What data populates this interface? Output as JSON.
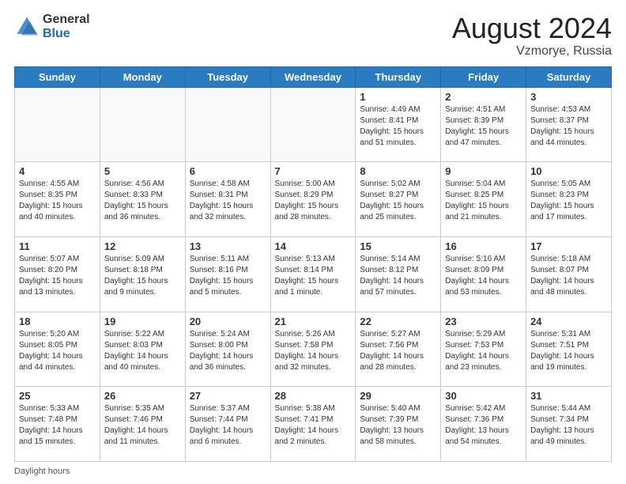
{
  "logo": {
    "general": "General",
    "blue": "Blue"
  },
  "title": {
    "month_year": "August 2024",
    "location": "Vzmorye, Russia"
  },
  "days_of_week": [
    "Sunday",
    "Monday",
    "Tuesday",
    "Wednesday",
    "Thursday",
    "Friday",
    "Saturday"
  ],
  "weeks": [
    [
      {
        "day": "",
        "info": ""
      },
      {
        "day": "",
        "info": ""
      },
      {
        "day": "",
        "info": ""
      },
      {
        "day": "",
        "info": ""
      },
      {
        "day": "1",
        "info": "Sunrise: 4:49 AM\nSunset: 8:41 PM\nDaylight: 15 hours\nand 51 minutes."
      },
      {
        "day": "2",
        "info": "Sunrise: 4:51 AM\nSunset: 8:39 PM\nDaylight: 15 hours\nand 47 minutes."
      },
      {
        "day": "3",
        "info": "Sunrise: 4:53 AM\nSunset: 8:37 PM\nDaylight: 15 hours\nand 44 minutes."
      }
    ],
    [
      {
        "day": "4",
        "info": "Sunrise: 4:55 AM\nSunset: 8:35 PM\nDaylight: 15 hours\nand 40 minutes."
      },
      {
        "day": "5",
        "info": "Sunrise: 4:56 AM\nSunset: 8:33 PM\nDaylight: 15 hours\nand 36 minutes."
      },
      {
        "day": "6",
        "info": "Sunrise: 4:58 AM\nSunset: 8:31 PM\nDaylight: 15 hours\nand 32 minutes."
      },
      {
        "day": "7",
        "info": "Sunrise: 5:00 AM\nSunset: 8:29 PM\nDaylight: 15 hours\nand 28 minutes."
      },
      {
        "day": "8",
        "info": "Sunrise: 5:02 AM\nSunset: 8:27 PM\nDaylight: 15 hours\nand 25 minutes."
      },
      {
        "day": "9",
        "info": "Sunrise: 5:04 AM\nSunset: 8:25 PM\nDaylight: 15 hours\nand 21 minutes."
      },
      {
        "day": "10",
        "info": "Sunrise: 5:05 AM\nSunset: 8:23 PM\nDaylight: 15 hours\nand 17 minutes."
      }
    ],
    [
      {
        "day": "11",
        "info": "Sunrise: 5:07 AM\nSunset: 8:20 PM\nDaylight: 15 hours\nand 13 minutes."
      },
      {
        "day": "12",
        "info": "Sunrise: 5:09 AM\nSunset: 8:18 PM\nDaylight: 15 hours\nand 9 minutes."
      },
      {
        "day": "13",
        "info": "Sunrise: 5:11 AM\nSunset: 8:16 PM\nDaylight: 15 hours\nand 5 minutes."
      },
      {
        "day": "14",
        "info": "Sunrise: 5:13 AM\nSunset: 8:14 PM\nDaylight: 15 hours\nand 1 minute."
      },
      {
        "day": "15",
        "info": "Sunrise: 5:14 AM\nSunset: 8:12 PM\nDaylight: 14 hours\nand 57 minutes."
      },
      {
        "day": "16",
        "info": "Sunrise: 5:16 AM\nSunset: 8:09 PM\nDaylight: 14 hours\nand 53 minutes."
      },
      {
        "day": "17",
        "info": "Sunrise: 5:18 AM\nSunset: 8:07 PM\nDaylight: 14 hours\nand 48 minutes."
      }
    ],
    [
      {
        "day": "18",
        "info": "Sunrise: 5:20 AM\nSunset: 8:05 PM\nDaylight: 14 hours\nand 44 minutes."
      },
      {
        "day": "19",
        "info": "Sunrise: 5:22 AM\nSunset: 8:03 PM\nDaylight: 14 hours\nand 40 minutes."
      },
      {
        "day": "20",
        "info": "Sunrise: 5:24 AM\nSunset: 8:00 PM\nDaylight: 14 hours\nand 36 minutes."
      },
      {
        "day": "21",
        "info": "Sunrise: 5:26 AM\nSunset: 7:58 PM\nDaylight: 14 hours\nand 32 minutes."
      },
      {
        "day": "22",
        "info": "Sunrise: 5:27 AM\nSunset: 7:56 PM\nDaylight: 14 hours\nand 28 minutes."
      },
      {
        "day": "23",
        "info": "Sunrise: 5:29 AM\nSunset: 7:53 PM\nDaylight: 14 hours\nand 23 minutes."
      },
      {
        "day": "24",
        "info": "Sunrise: 5:31 AM\nSunset: 7:51 PM\nDaylight: 14 hours\nand 19 minutes."
      }
    ],
    [
      {
        "day": "25",
        "info": "Sunrise: 5:33 AM\nSunset: 7:48 PM\nDaylight: 14 hours\nand 15 minutes."
      },
      {
        "day": "26",
        "info": "Sunrise: 5:35 AM\nSunset: 7:46 PM\nDaylight: 14 hours\nand 11 minutes."
      },
      {
        "day": "27",
        "info": "Sunrise: 5:37 AM\nSunset: 7:44 PM\nDaylight: 14 hours\nand 6 minutes."
      },
      {
        "day": "28",
        "info": "Sunrise: 5:38 AM\nSunset: 7:41 PM\nDaylight: 14 hours\nand 2 minutes."
      },
      {
        "day": "29",
        "info": "Sunrise: 5:40 AM\nSunset: 7:39 PM\nDaylight: 13 hours\nand 58 minutes."
      },
      {
        "day": "30",
        "info": "Sunrise: 5:42 AM\nSunset: 7:36 PM\nDaylight: 13 hours\nand 54 minutes."
      },
      {
        "day": "31",
        "info": "Sunrise: 5:44 AM\nSunset: 7:34 PM\nDaylight: 13 hours\nand 49 minutes."
      }
    ]
  ],
  "footer": {
    "label": "Daylight hours"
  }
}
